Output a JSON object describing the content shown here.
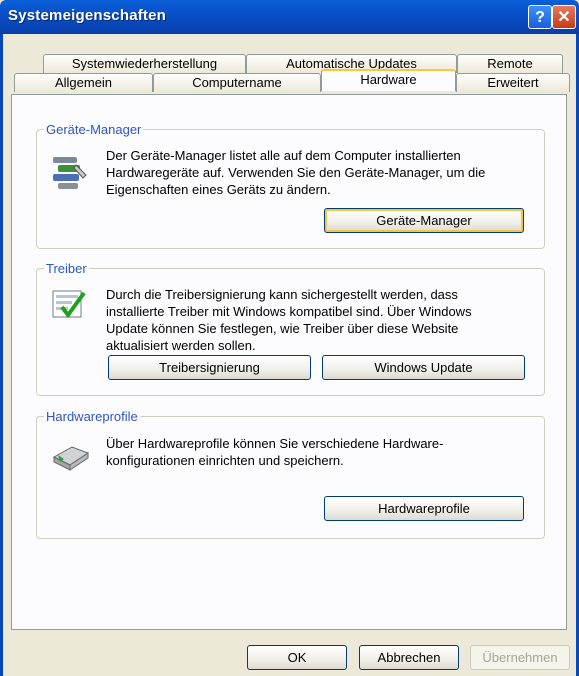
{
  "window": {
    "title": "Systemeigenschaften",
    "help_glyph": "?",
    "close_glyph": "✕"
  },
  "tabs_row1": [
    "Systemwiederherstellung",
    "Automatische Updates",
    "Remote"
  ],
  "tabs_row2": [
    "Allgemein",
    "Computername",
    "Hardware",
    "Erweitert"
  ],
  "geraete": {
    "legend": "Geräte-Manager",
    "line1": "Der Geräte-Manager listet alle auf dem Computer installierten",
    "line2": "Hardwaregeräte auf. Verwenden Sie den Geräte-Manager, um die",
    "line3": "Eigenschaften eines Geräts zu ändern.",
    "button": "Geräte-Manager"
  },
  "treiber": {
    "legend": "Treiber",
    "line1": "Durch die Treibersignierung kann sichergestellt werden, dass",
    "line2": "installierte Treiber mit Windows kompatibel sind. Über Windows",
    "line3": "Update können Sie festlegen, wie Treiber über diese Website",
    "line4": "aktualisiert werden sollen.",
    "button_sign": "Treibersignierung",
    "button_update": "Windows Update"
  },
  "profile": {
    "legend": "Hardwareprofile",
    "line1": "Über Hardwareprofile können Sie verschiedene Hardware-",
    "line2": "konfigurationen einrichten und speichern.",
    "button": "Hardwareprofile"
  },
  "footer": {
    "ok": "OK",
    "cancel": "Abbrechen",
    "apply": "Übernehmen"
  }
}
